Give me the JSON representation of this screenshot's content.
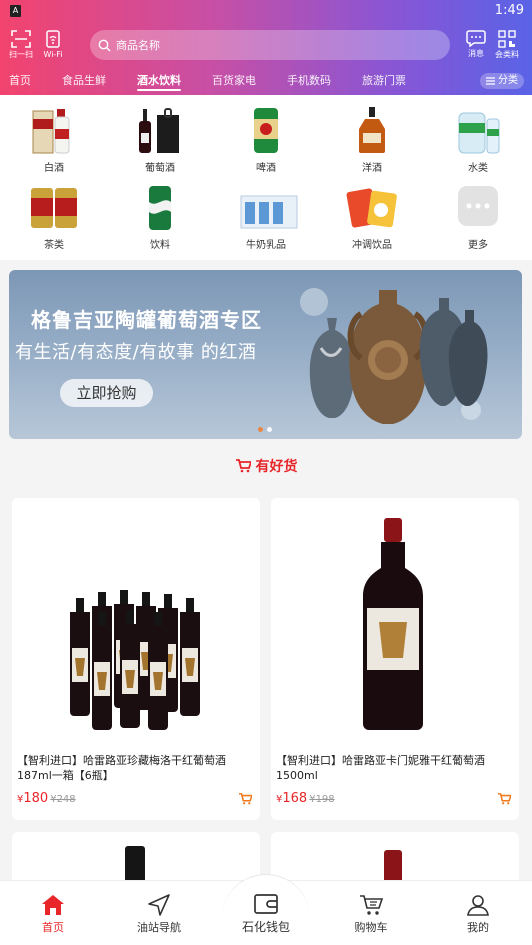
{
  "status": {
    "app_badge": "A",
    "time": "1:49"
  },
  "header": {
    "scan_label": "扫一扫",
    "wifi_label": "Wi-Fi",
    "search_placeholder": "商品名称",
    "message_label": "消息",
    "category_label": "会类料",
    "accent": "#e8262a"
  },
  "tabs": [
    {
      "label": "首页",
      "active": false
    },
    {
      "label": "食品生鲜",
      "active": false
    },
    {
      "label": "酒水饮料",
      "active": true
    },
    {
      "label": "百货家电",
      "active": false
    },
    {
      "label": "手机数码",
      "active": false
    },
    {
      "label": "旅游门票",
      "active": false
    }
  ],
  "category_button": "分类",
  "categories": [
    {
      "label": "白酒",
      "icon": "baijiu-icon"
    },
    {
      "label": "葡萄酒",
      "icon": "wine-icon"
    },
    {
      "label": "啤酒",
      "icon": "beer-icon"
    },
    {
      "label": "洋酒",
      "icon": "brandy-icon"
    },
    {
      "label": "水类",
      "icon": "water-icon"
    },
    {
      "label": "茶类",
      "icon": "tea-icon"
    },
    {
      "label": "饮料",
      "icon": "soda-icon"
    },
    {
      "label": "牛奶乳品",
      "icon": "milk-icon"
    },
    {
      "label": "冲调饮品",
      "icon": "drink-mix-icon"
    },
    {
      "label": "更多",
      "icon": "more-icon"
    }
  ],
  "banner": {
    "title": "格鲁吉亚陶罐葡萄酒专区",
    "subtitle": "有生活/有态度/有故事 的红酒",
    "button": "立即抢购"
  },
  "section_title": "有好货",
  "products": [
    {
      "title": "【智利进口】哈雷路亚珍藏梅洛干红葡萄酒187ml一箱【6瓶】",
      "currency": "¥",
      "price": "180",
      "old_price": "¥248"
    },
    {
      "title": "【智利进口】哈雷路亚卡门妮雅干红葡萄酒1500ml",
      "currency": "¥",
      "price": "168",
      "old_price": "¥198"
    }
  ],
  "bottom_nav": [
    {
      "label": "首页",
      "icon": "home-icon",
      "active": true
    },
    {
      "label": "油站导航",
      "icon": "navigation-icon",
      "active": false
    },
    {
      "label": "石化钱包",
      "icon": "wallet-icon",
      "active": false
    },
    {
      "label": "购物车",
      "icon": "cart-icon",
      "active": false
    },
    {
      "label": "我的",
      "icon": "profile-icon",
      "active": false
    }
  ]
}
